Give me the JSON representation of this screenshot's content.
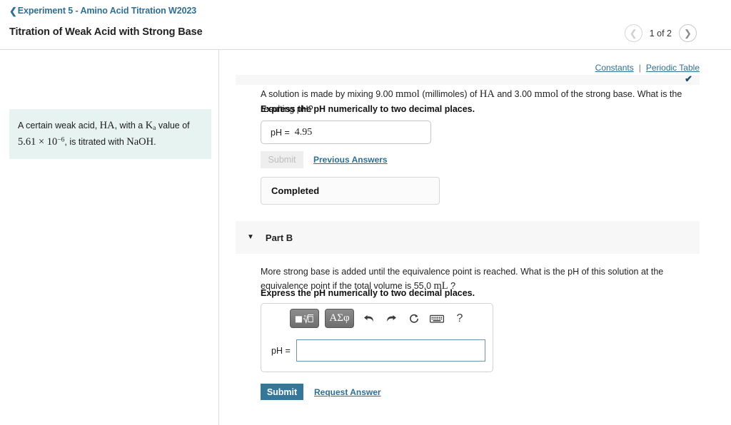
{
  "header": {
    "breadcrumb_icon": "chevron-left-icon",
    "breadcrumb_label": "Experiment 5 - Amino Acid Titration W2023",
    "assignment_title": "Titration of Weak Acid with Strong Base",
    "pager": {
      "prev_icon": "chevron-left-icon",
      "next_icon": "chevron-right-icon",
      "label": "1 of 2"
    }
  },
  "left_panel": {
    "problem_statement": {
      "text_1": "A certain weak acid, ",
      "formula_1": "HA",
      "text_2": ", with a ",
      "k_symbol": "K",
      "k_subscript": "a",
      "text_3": " value of ",
      "value_mantissa": "5.61 × 10",
      "value_exponent": "−6",
      "text_4": ", is titrated with ",
      "formula_2": "NaOH",
      "text_5": "."
    }
  },
  "right_panel": {
    "top_links": {
      "constants": "Constants",
      "separator": "|",
      "periodic_table": "Periodic Table"
    },
    "part_a": {
      "status_check_icon": "check-icon",
      "question_prefix": "A solution is made by mixing 9.00 ",
      "unit_1": "mmol",
      "question_mid_1": " (millimoles) of ",
      "formula": "HA",
      "question_mid_2": " and 3.00 ",
      "unit_2": "mmol",
      "question_suffix": " of the strong base. What is the resulting pH?",
      "instruction": "Express the pH numerically to two decimal places.",
      "answer_label": "pH =",
      "answer_value": "4.95",
      "submit_label": "Submit",
      "previous_answers_label": "Previous Answers",
      "status_label": "Completed"
    },
    "part_b": {
      "caret_icon": "caret-down-icon",
      "label": "Part B",
      "question_prefix": "More strong base is added until the equivalence point is reached. What is the pH of this solution at the equivalence point if the total volume is 55.0 ",
      "unit": "mL",
      "question_suffix": " ?",
      "instruction": "Express the pH numerically to two decimal places.",
      "toolbar": {
        "templates_icon": "math-templates-icon",
        "greek_label": "ΑΣφ",
        "undo_icon": "undo-arrow-icon",
        "redo_icon": "redo-arrow-icon",
        "reset_icon": "reset-circular-arrow-icon",
        "keyboard_icon": "keyboard-icon",
        "help_label": "?"
      },
      "answer_label": "pH =",
      "answer_value": "",
      "answer_placeholder": "",
      "submit_label": "Submit",
      "request_answer_label": "Request Answer"
    }
  },
  "colors": {
    "link_blue": "#2e6f93",
    "submit_blue": "#35779b",
    "statement_bg": "#e7f3f1",
    "band_gray": "#f7f7f7",
    "check_navy": "#1f4e66"
  }
}
